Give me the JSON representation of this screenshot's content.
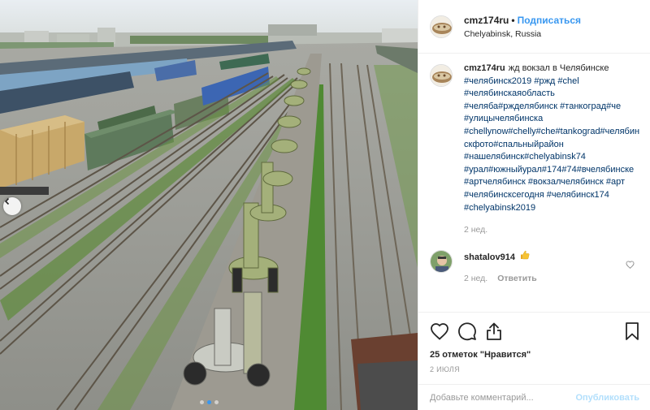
{
  "post": {
    "author": {
      "username": "cmz174ru",
      "follow_label": "Подписаться",
      "location": "Chelyabinsk, Russia"
    },
    "caption": {
      "username": "cmz174ru",
      "text": "жд вокзал в Челябинске",
      "hashtags": "#челябинск2019 #ржд #chel #челябинскаяобласть #челяба#ржделябинск #танкоград#че #улицычелябинска #chellynow#chelly#che#tankograd#челябинскфото#спальныйрайон #нашелябинск#chelyabinsk74 #урал#южныйурал#174#74#вчелябинске #артчелябинск #вокзалчелябинск #арт #челябинсксегодня #челябинск174 #chelyabinsk2019",
      "time": "2 нед."
    },
    "comments": [
      {
        "username": "shatalov914",
        "text_emoji": "thumbs-up",
        "time": "2 нед.",
        "reply_label": "Ответить"
      }
    ],
    "likes": "25 отметок \"Нравится\"",
    "date": "2 июля",
    "comment_placeholder": "Добавьте комментарий...",
    "publish_label": "Опубликовать",
    "carousel": {
      "total": 3,
      "current": 2
    }
  },
  "icons": {
    "prev": "chevron-left-icon",
    "like": "heart-icon",
    "comment": "comment-icon",
    "share": "share-icon",
    "save": "bookmark-icon",
    "comment_like": "small-heart-icon"
  },
  "colors": {
    "link_blue": "#3897f0",
    "hashtag": "#003569",
    "muted": "#999999",
    "publish_disabled": "#b2dffc"
  }
}
